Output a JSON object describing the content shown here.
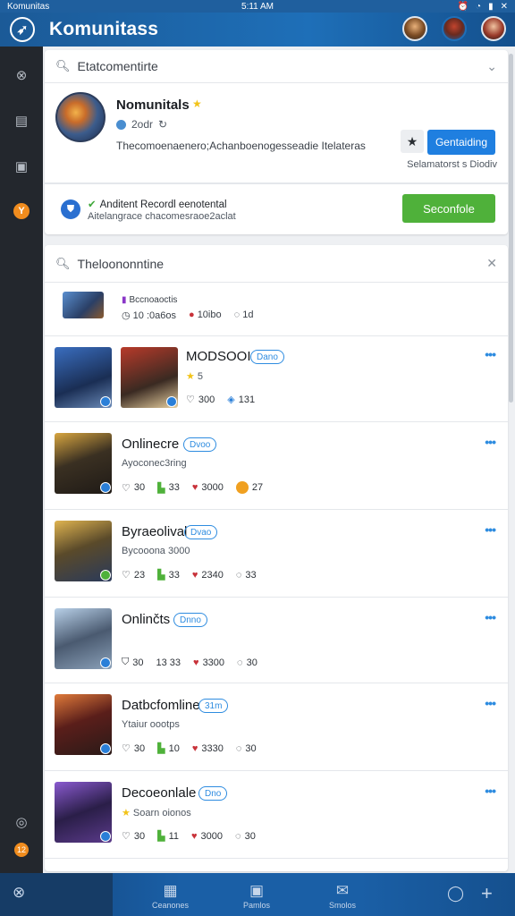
{
  "statusbar": {
    "left": "Komunitas",
    "time": "5:11 AM",
    "right_icons": [
      "alarm-icon",
      "wifi-icon",
      "battery-icon",
      "close-icon"
    ]
  },
  "appbar": {
    "title": "Komunitass",
    "logo_icon": "app-logo-icon",
    "avatars": [
      "warrior-avatar",
      "knight-avatar",
      "hero-avatar"
    ]
  },
  "sidebar": {
    "items": [
      {
        "icon": "compass-icon",
        "glyph": "◯"
      },
      {
        "icon": "inbox-icon",
        "glyph": "▤"
      },
      {
        "icon": "book-icon",
        "glyph": "▣"
      },
      {
        "icon": "community-icon",
        "glyph": "Y",
        "active": true
      }
    ],
    "bottom_items": [
      {
        "icon": "settings-icon",
        "glyph": "◎"
      },
      {
        "icon": "notifications-icon",
        "glyph": "12"
      }
    ]
  },
  "card1": {
    "search_label": "Etatcomentirte",
    "profile": {
      "name": "Nomunitals",
      "meta": "2odr",
      "description": "Thecomoenaenero;Achanboenogesseadie Itelateras",
      "follow_label": "Gentaiding",
      "sub_line": "Selamatorst s Diodiv"
    },
    "promo": {
      "title": "Anditent Recordl eenotental",
      "subtitle": "Aitelangrace chacomesraoe2aclat",
      "button_label": "Seconfole"
    }
  },
  "card2": {
    "search_label": "Theloononntine",
    "mini": {
      "title": "Bccnoaoctis",
      "stats": [
        "10 :0a6os",
        "10ibo",
        "1d"
      ]
    },
    "games": [
      {
        "title": "MODSOOI",
        "tag": "Dano",
        "rating": "5",
        "stats": [
          {
            "icon": "heart-outline-icon",
            "value": "300"
          },
          {
            "icon": "share-icon",
            "value": "131"
          }
        ]
      },
      {
        "title": "Onlinecre",
        "tag": "Dvoo",
        "sub": "Ayoconec3ring",
        "stats": [
          {
            "icon": "heart-outline-icon",
            "value": "30"
          },
          {
            "icon": "gift-icon",
            "value": "33"
          },
          {
            "icon": "heart-icon",
            "value": "3000"
          },
          {
            "icon": "coin-icon",
            "value": "27"
          }
        ]
      },
      {
        "title": "Byraeolival",
        "tag": "Dvao",
        "sub": "Bycooona 3000",
        "stats": [
          {
            "icon": "heart-outline-icon",
            "value": "23"
          },
          {
            "icon": "gift-icon",
            "value": "33"
          },
          {
            "icon": "heart-icon",
            "value": "2340"
          },
          {
            "icon": "comment-icon",
            "value": "33"
          }
        ]
      },
      {
        "title": "Onlinčts",
        "tag": "Dnno",
        "stats": [
          {
            "icon": "shield-icon",
            "value": "30"
          },
          {
            "icon": "dot-icon",
            "value": "13 33"
          },
          {
            "icon": "heart-icon",
            "value": "3300"
          },
          {
            "icon": "comment-icon",
            "value": "30"
          }
        ]
      },
      {
        "title": "Datbcfomline",
        "tag": "31m",
        "sub": "Ytaiur oootps",
        "stats": [
          {
            "icon": "heart-outline-icon",
            "value": "30"
          },
          {
            "icon": "gift-icon",
            "value": "10"
          },
          {
            "icon": "heart-icon",
            "value": "3330"
          },
          {
            "icon": "comment-icon",
            "value": "30"
          }
        ]
      },
      {
        "title": "Decoeonlale",
        "tag": "Dno",
        "sub": "Soarn oionos",
        "stats": [
          {
            "icon": "heart-outline-icon",
            "value": "30"
          },
          {
            "icon": "gift-icon",
            "value": "11"
          },
          {
            "icon": "heart-icon",
            "value": "3000"
          },
          {
            "icon": "comment-icon",
            "value": "30"
          }
        ]
      }
    ]
  },
  "bottombar": {
    "items": [
      {
        "icon": "compass-icon",
        "label": ""
      },
      {
        "icon": "store-icon",
        "label": "Ceanones"
      },
      {
        "icon": "game-icon",
        "label": "Pamlos"
      },
      {
        "icon": "mail-icon",
        "label": "Smolos"
      },
      {
        "icon": "circle-icon",
        "label": ""
      },
      {
        "icon": "plus-icon",
        "label": ""
      }
    ]
  },
  "colors": {
    "appbar": "#1e6fb8",
    "sidebar": "#23272d",
    "accent_blue": "#1f7fe0",
    "accent_green": "#4fb13a",
    "accent_orange": "#f08c1e"
  }
}
